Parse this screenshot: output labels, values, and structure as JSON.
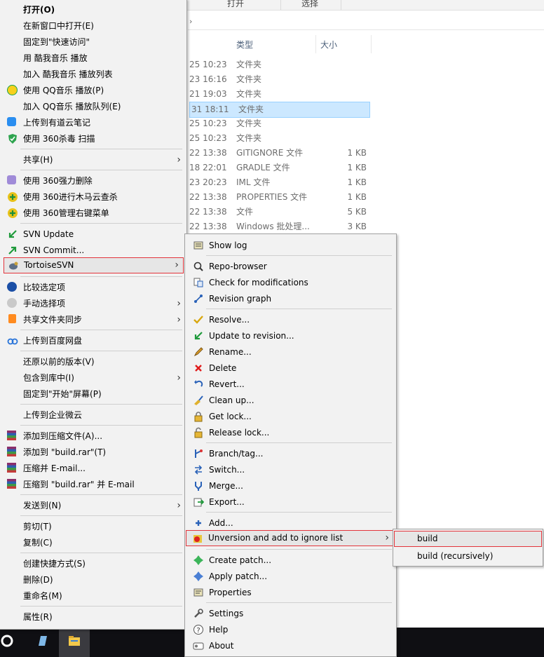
{
  "explorer": {
    "ribbon_tabs": [
      "打开",
      "选择"
    ],
    "columns": {
      "type": "类型",
      "size": "大小"
    },
    "rows": [
      {
        "date": "25 10:23",
        "type": "文件夹",
        "size": "",
        "selected": false
      },
      {
        "date": "23 16:16",
        "type": "文件夹",
        "size": "",
        "selected": false
      },
      {
        "date": "21 19:03",
        "type": "文件夹",
        "size": "",
        "selected": false
      },
      {
        "date": "31 18:11",
        "type": "文件夹",
        "size": "",
        "selected": true
      },
      {
        "date": "25 10:23",
        "type": "文件夹",
        "size": "",
        "selected": false
      },
      {
        "date": "25 10:23",
        "type": "文件夹",
        "size": "",
        "selected": false
      },
      {
        "date": "22 13:38",
        "type": "GITIGNORE 文件",
        "size": "1 KB",
        "selected": false
      },
      {
        "date": "18 22:01",
        "type": "GRADLE 文件",
        "size": "1 KB",
        "selected": false
      },
      {
        "date": "23 20:23",
        "type": "IML 文件",
        "size": "1 KB",
        "selected": false
      },
      {
        "date": "22 13:38",
        "type": "PROPERTIES 文件",
        "size": "1 KB",
        "selected": false
      },
      {
        "date": "22 13:38",
        "type": "文件",
        "size": "5 KB",
        "selected": false
      },
      {
        "date": "22 13:38",
        "type": "Windows 批处理...",
        "size": "3 KB",
        "selected": false
      }
    ]
  },
  "context_menu": {
    "items": [
      {
        "label": "打开(O)"
      },
      {
        "label": "在新窗口中打开(E)"
      },
      {
        "label": "固定到\"快速访问\""
      },
      {
        "label": "用 酷我音乐 播放"
      },
      {
        "label": "加入 酷我音乐 播放列表"
      },
      {
        "label": "使用 QQ音乐 播放(P)"
      },
      {
        "label": "加入 QQ音乐 播放队列(E)"
      },
      {
        "label": "上传到有道云笔记"
      },
      {
        "label": "使用 360杀毒 扫描"
      },
      {
        "label": "共享(H)"
      },
      {
        "label": "使用 360强力删除"
      },
      {
        "label": "使用 360进行木马云查杀"
      },
      {
        "label": "使用 360管理右键菜单"
      },
      {
        "label": "SVN Update"
      },
      {
        "label": "SVN Commit..."
      },
      {
        "label": "TortoiseSVN"
      },
      {
        "label": "比较选定项"
      },
      {
        "label": "手动选择项"
      },
      {
        "label": "共享文件夹同步"
      },
      {
        "label": "上传到百度网盘"
      },
      {
        "label": "还原以前的版本(V)"
      },
      {
        "label": "包含到库中(I)"
      },
      {
        "label": "固定到\"开始\"屏幕(P)"
      },
      {
        "label": "上传到企业微云"
      },
      {
        "label": "添加到压缩文件(A)..."
      },
      {
        "label": "添加到 \"build.rar\"(T)"
      },
      {
        "label": "压缩并 E-mail..."
      },
      {
        "label": "压缩到 \"build.rar\" 并 E-mail"
      },
      {
        "label": "发送到(N)"
      },
      {
        "label": "剪切(T)"
      },
      {
        "label": "复制(C)"
      },
      {
        "label": "创建快捷方式(S)"
      },
      {
        "label": "删除(D)"
      },
      {
        "label": "重命名(M)"
      },
      {
        "label": "属性(R)"
      }
    ]
  },
  "svn_menu": {
    "items": [
      {
        "label": "Show log"
      },
      {
        "label": "Repo-browser"
      },
      {
        "label": "Check for modifications"
      },
      {
        "label": "Revision graph"
      },
      {
        "label": "Resolve..."
      },
      {
        "label": "Update to revision..."
      },
      {
        "label": "Rename..."
      },
      {
        "label": "Delete"
      },
      {
        "label": "Revert..."
      },
      {
        "label": "Clean up..."
      },
      {
        "label": "Get lock..."
      },
      {
        "label": "Release lock..."
      },
      {
        "label": "Branch/tag..."
      },
      {
        "label": "Switch..."
      },
      {
        "label": "Merge..."
      },
      {
        "label": "Export..."
      },
      {
        "label": "Add..."
      },
      {
        "label": "Unversion and add to ignore list"
      },
      {
        "label": "Create patch..."
      },
      {
        "label": "Apply patch..."
      },
      {
        "label": "Properties"
      },
      {
        "label": "Settings"
      },
      {
        "label": "Help"
      },
      {
        "label": "About"
      }
    ]
  },
  "ignore_menu": {
    "items": [
      {
        "label": "build"
      },
      {
        "label": "build (recursively)"
      }
    ]
  },
  "colors": {
    "highlight_border": "#e3343b",
    "selection_bg": "#cce8ff",
    "menu_bg": "#f2f2f2"
  }
}
